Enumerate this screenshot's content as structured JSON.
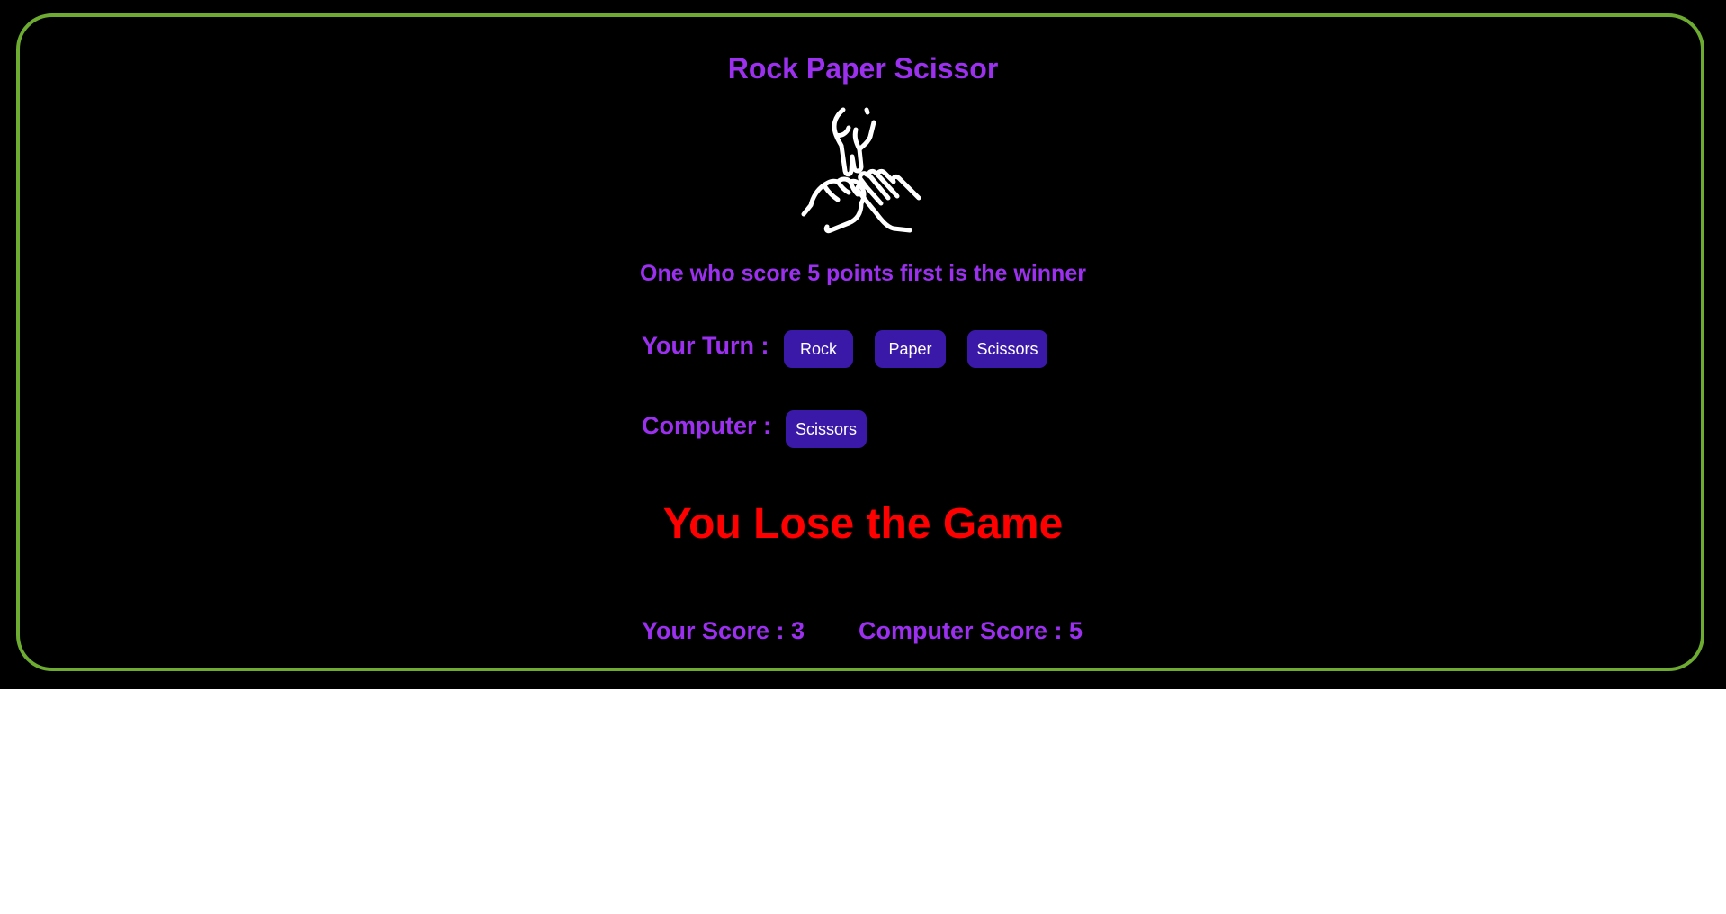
{
  "game": {
    "title": "Rock Paper Scissor",
    "logo_icon": "rock-paper-scissors-hands-icon",
    "rule_text": "One who score 5 points first is the winner",
    "your_turn_label": "Your Turn :",
    "choices": [
      "Rock",
      "Paper",
      "Scissors"
    ],
    "computer_label": "Computer :",
    "computer_choice": "Scissors",
    "result_text": "You Lose the Game",
    "your_score_text": "Your Score : 3",
    "computer_score_text": "Computer Score : 5"
  },
  "colors": {
    "background": "#000000",
    "border": "#6dab31",
    "accent_text": "#9b30ef",
    "button_bg": "#3a18a8",
    "result_text": "#ff0000"
  }
}
